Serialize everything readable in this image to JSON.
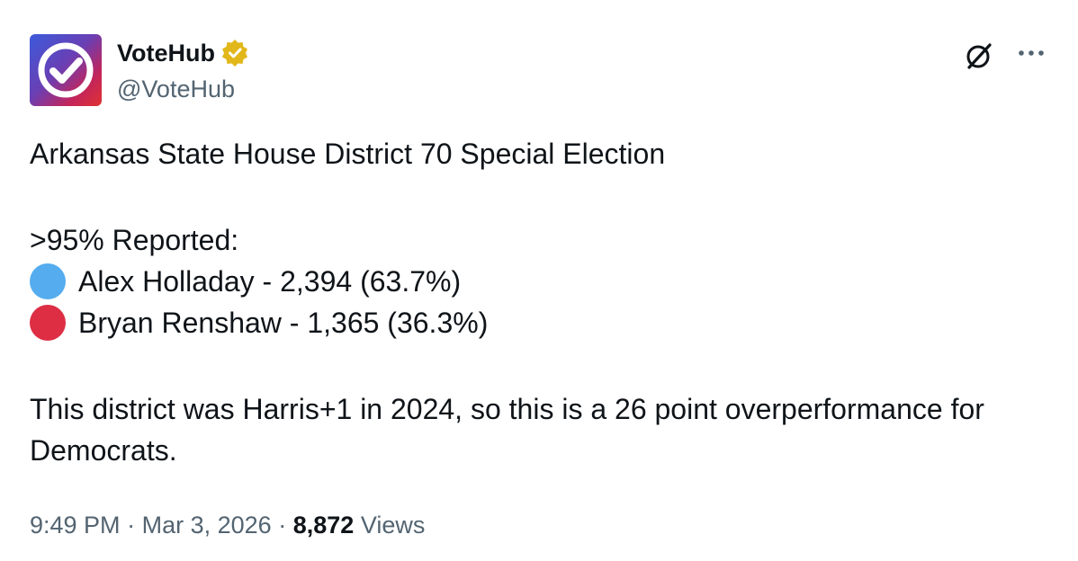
{
  "author": {
    "display_name": "VoteHub",
    "handle": "@VoteHub",
    "avatar_icon": "votehub-check-logo-icon",
    "verified_icon": "verified-badge-icon",
    "verified_color": "#e2b719"
  },
  "header_actions": {
    "grok_icon": "grok-icon",
    "more_icon": "more-options-icon"
  },
  "post": {
    "title_line": "Arkansas State House District 70 Special Election",
    "reported_line": ">95% Reported:",
    "candidates": [
      {
        "text": "Alex Holladay - 2,394 (63.7%)",
        "color": "#55acee",
        "marker": "blue-circle-icon"
      },
      {
        "text": "Bryan Renshaw - 1,365 (36.3%)",
        "color": "#dd2e44",
        "marker": "red-circle-icon"
      }
    ],
    "closing": "This district was Harris+1 in 2024, so this is a 26 point overperformance for Democrats."
  },
  "meta": {
    "time": "9:49 PM",
    "separator": "·",
    "date": "Mar 3, 2026",
    "views_count": "8,872",
    "views_label": "Views"
  }
}
